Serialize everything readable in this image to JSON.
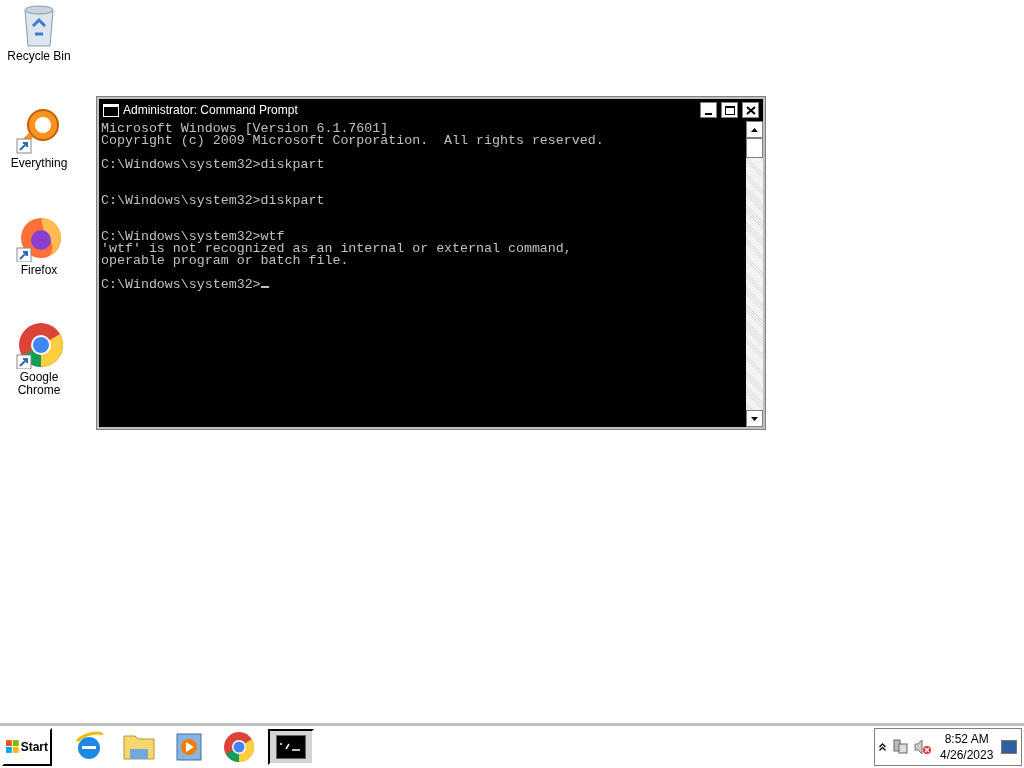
{
  "desktop_icons": [
    {
      "kind": "recycle",
      "label": "Recycle Bin"
    },
    {
      "kind": "everything",
      "label": "Everything"
    },
    {
      "kind": "firefox",
      "label": "Firefox"
    },
    {
      "kind": "chrome",
      "label": "Google Chrome"
    }
  ],
  "window": {
    "title": "Administrator: Command Prompt",
    "cursor": true,
    "lines": [
      {
        "kind": "text",
        "text": "Microsoft Windows [Version 6.1.7601]"
      },
      {
        "kind": "text",
        "text": "Copyright (c) 2009 Microsoft Corporation.  All rights reserved."
      },
      {
        "kind": "blank"
      },
      {
        "kind": "text",
        "text": "C:\\Windows\\system32>diskpart"
      },
      {
        "kind": "blank"
      },
      {
        "kind": "blank"
      },
      {
        "kind": "text",
        "text": "C:\\Windows\\system32>diskpart"
      },
      {
        "kind": "blank"
      },
      {
        "kind": "blank"
      },
      {
        "kind": "text",
        "text": "C:\\Windows\\system32>wtf"
      },
      {
        "kind": "text",
        "text": "'wtf' is not recognized as an internal or external command,"
      },
      {
        "kind": "text",
        "text": "operable program or batch file."
      },
      {
        "kind": "blank"
      },
      {
        "kind": "prompt",
        "text": "C:\\Windows\\system32>"
      }
    ]
  },
  "taskbar": {
    "start": "Start",
    "apps": [
      {
        "kind": "ie",
        "selected": false
      },
      {
        "kind": "explorer",
        "selected": false
      },
      {
        "kind": "media",
        "selected": false
      },
      {
        "kind": "chrome",
        "selected": false
      },
      {
        "kind": "cmd",
        "selected": true
      }
    ]
  },
  "tray": {
    "time": "8:52 AM",
    "date": "4/26/2023"
  }
}
